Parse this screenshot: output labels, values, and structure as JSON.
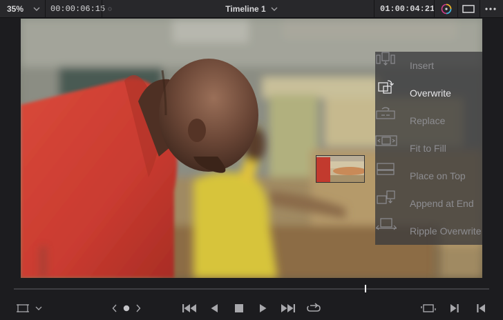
{
  "topbar": {
    "zoom": "35%",
    "timecode_left": "00:00:06:15",
    "timeline_name": "Timeline 1",
    "timecode_right": "01:00:04:21",
    "icons": [
      "chevron-down-icon",
      "color-wheel-icon",
      "viewer-layout-icon",
      "more-options-icon"
    ]
  },
  "overlay": {
    "items": [
      {
        "label": "Insert",
        "icon": "insert-icon",
        "active": false
      },
      {
        "label": "Overwrite",
        "icon": "overwrite-icon",
        "active": true
      },
      {
        "label": "Replace",
        "icon": "replace-icon",
        "active": false
      },
      {
        "label": "Fit to Fill",
        "icon": "fit-to-fill-icon",
        "active": false
      },
      {
        "label": "Place on Top",
        "icon": "place-on-top-icon",
        "active": false
      },
      {
        "label": "Append at End",
        "icon": "append-at-end-icon",
        "active": false
      },
      {
        "label": "Ripple Overwrite",
        "icon": "ripple-overwrite-icon",
        "active": false
      }
    ]
  },
  "scrubber": {
    "playhead_fraction": 0.74
  },
  "controls": {
    "icons": [
      "safe-area-icon",
      "prev-clip-icon",
      "jog-dot-icon",
      "next-clip-icon",
      "go-to-start-icon",
      "play-reverse-icon",
      "stop-icon",
      "play-icon",
      "go-to-end-icon",
      "loop-icon",
      "match-frame-icon",
      "mark-out-icon",
      "mark-in-icon"
    ]
  },
  "colors": {
    "background": "#1c1c1f",
    "topbar": "#28282b",
    "overlay": "#3a3a3c",
    "text": "#d8d8da",
    "inactive_text": "#8d8d91"
  }
}
